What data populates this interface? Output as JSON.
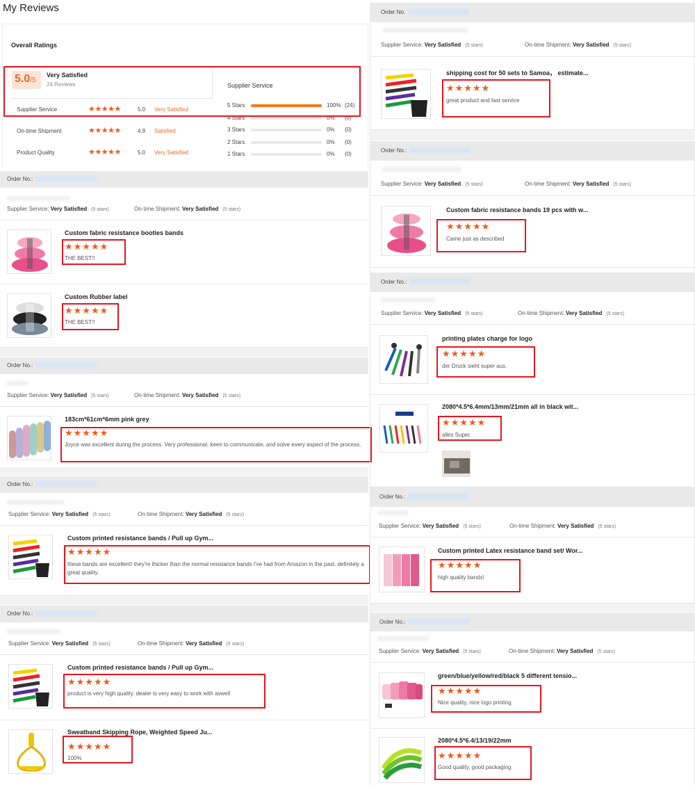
{
  "page_title": "My Reviews",
  "overall": {
    "heading": "Overall Ratings",
    "score": "5.0",
    "score_of": "/5",
    "label": "Very Satisfied",
    "reviews": "24 Reviews",
    "rows": [
      {
        "label": "Supplier Service",
        "value": "5.0",
        "status": "Very Satisfied"
      },
      {
        "label": "On-time Shipment",
        "value": "4.9",
        "status": "Satisfied"
      },
      {
        "label": "Product Quality",
        "value": "5.0",
        "status": "Very Satisfied"
      }
    ],
    "dist_title": "Supplier Service",
    "dist": [
      {
        "label": "5 Stars",
        "pct": "100%",
        "count": "(24)",
        "fraction": 1.0
      },
      {
        "label": "4 Stars",
        "pct": "0%",
        "count": "(0)",
        "fraction": 0
      },
      {
        "label": "3 Stars",
        "pct": "0%",
        "count": "(0)",
        "fraction": 0
      },
      {
        "label": "2 Stars",
        "pct": "0%",
        "count": "(0)",
        "fraction": 0
      },
      {
        "label": "1 Stars",
        "pct": "0%",
        "count": "(0)",
        "fraction": 0
      }
    ]
  },
  "labels": {
    "order_no": "Order No.:",
    "order_no_alt": "Order No.",
    "supplier_service": "Supplier Service:",
    "ontime_shipment": "On-time Shipment:",
    "very_satisfied": "Very Satisfied",
    "five_stars": "(5 stars)"
  },
  "star_glyphs": "★★★★★",
  "colors": {
    "accent": "#f05a1a",
    "highlight": "#e8141c",
    "bar": "#e9e9e9"
  },
  "reviews": {
    "l1a": {
      "title": "Custom fabric resistance booties bands",
      "text": "THE BEST!!"
    },
    "l1b": {
      "title": "Custom Rubber label",
      "text": "THE BEST!!"
    },
    "l2a": {
      "title": "183cm*61cm*6mm pink grey",
      "text": "Joyce was excellent during the process. Very professional, keen to communicate, and solve every aspect of the process."
    },
    "l3a": {
      "title": "Custom printed resistance bands / Pull up Gym...",
      "text": "these bands are excellent! they're thicker than the normal resistance bands I've had from Amazon in the past. definitely a great quality."
    },
    "l4a": {
      "title": "Custom printed resistance bands / Pull up Gym...",
      "text": "product is very high quality. dealer is very easy to work with aswell"
    },
    "l4b": {
      "title": "Sweatband Skipping Rope, Weighted Speed Ju...",
      "text": "100%"
    },
    "r1a": {
      "title": "shipping cost for 50 sets to Samoa， estimate...",
      "text": "great product and fast service"
    },
    "r2a": {
      "title": "Custom fabric resistance bands 19 pcs with w...",
      "text": "Came just as described"
    },
    "r3a": {
      "title": "printing plates charge for logo",
      "text": "der Druck sieht super aus."
    },
    "r3b": {
      "title": "2080*4.5*6.4mm/13mm/21mm all in black wit...",
      "text": "alles Super."
    },
    "r4a": {
      "title": "Custom printed Latex resistance band set/ Wor...",
      "text": "high quality bands!"
    },
    "r5a": {
      "title": "green/blue/yellow/red/black 5 different tensio...",
      "text": "Nice quality, nice logo printing"
    },
    "r5b": {
      "title": "2080*4.5*6.4/13/19/22mm",
      "text": "Good quality, good packaging"
    }
  }
}
